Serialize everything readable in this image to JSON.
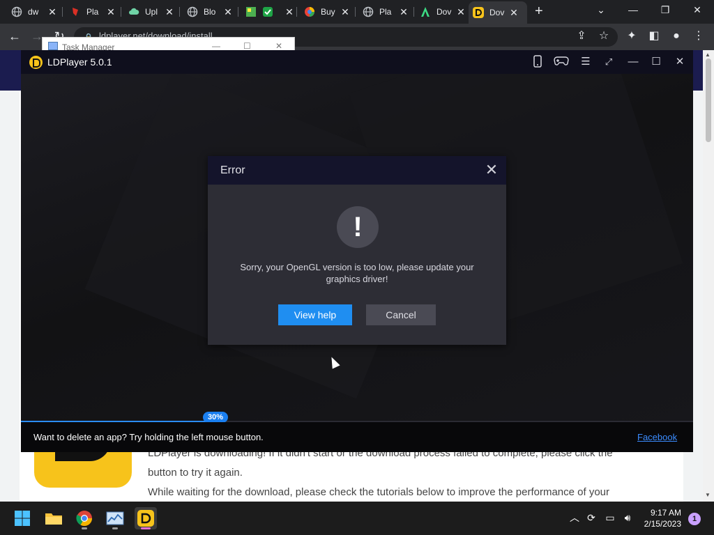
{
  "browser": {
    "tabs": [
      {
        "label": "dw",
        "icon": "globe-icon"
      },
      {
        "label": "Pla",
        "icon": "red-shape-icon"
      },
      {
        "label": "Upl",
        "icon": "cloud-icon"
      },
      {
        "label": "Blo",
        "icon": "globe-icon"
      },
      {
        "label": "",
        "icon": "app-icon"
      },
      {
        "label": "Buy",
        "icon": "colorful-circle-icon"
      },
      {
        "label": "Pla",
        "icon": "globe-icon"
      },
      {
        "label": "Dov",
        "icon": "letter-a-icon"
      },
      {
        "label": "Dov",
        "icon": "ldplayer-icon"
      }
    ],
    "new_tab": "+",
    "url": "ldplayer.net/download/install"
  },
  "task_manager": {
    "title": "Task Manager"
  },
  "page": {
    "line1": "LDPlayer is downloading! If it didn't start or the download process failed to complete, please click the",
    "line2": "button to try it again.",
    "line3": "While waiting for the download, please check the tutorials below to improve the performance of your"
  },
  "ldplayer": {
    "title": "LDPlayer 5.0.1",
    "progress_percent": 30,
    "progress_label": "30%",
    "tip": "Want to delete an app? Try holding the left mouse button.",
    "link": "Facebook"
  },
  "dialog": {
    "title": "Error",
    "message": "Sorry, your OpenGL version is too low, please update your graphics driver!",
    "primary_button": "View help",
    "secondary_button": "Cancel",
    "alert_glyph": "!"
  },
  "taskbar": {
    "time": "9:17 AM",
    "date": "2/15/2023",
    "notification_count": "1"
  },
  "colors": {
    "accent": "#1f8ef1",
    "ldplayer_yellow": "#f7c31b",
    "progress_blue": "#2a8cff"
  }
}
